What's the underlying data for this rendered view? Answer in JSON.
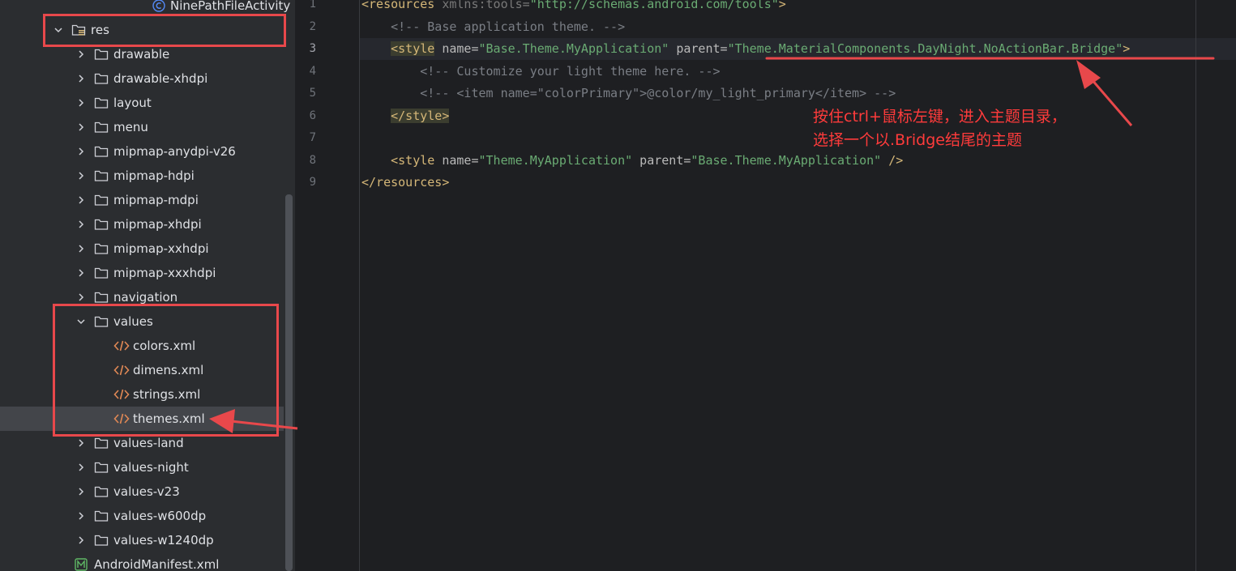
{
  "sidebar": {
    "items": [
      {
        "label": "NinePathFileActivity",
        "icon": "class-icon",
        "expanded": null
      },
      {
        "label": "res",
        "icon": "resource-folder-icon",
        "expanded": true
      },
      {
        "label": "drawable",
        "icon": "folder-icon",
        "expanded": false
      },
      {
        "label": "drawable-xhdpi",
        "icon": "folder-icon",
        "expanded": false
      },
      {
        "label": "layout",
        "icon": "folder-icon",
        "expanded": false
      },
      {
        "label": "menu",
        "icon": "folder-icon",
        "expanded": false
      },
      {
        "label": "mipmap-anydpi-v26",
        "icon": "folder-icon",
        "expanded": false
      },
      {
        "label": "mipmap-hdpi",
        "icon": "folder-icon",
        "expanded": false
      },
      {
        "label": "mipmap-mdpi",
        "icon": "folder-icon",
        "expanded": false
      },
      {
        "label": "mipmap-xhdpi",
        "icon": "folder-icon",
        "expanded": false
      },
      {
        "label": "mipmap-xxhdpi",
        "icon": "folder-icon",
        "expanded": false
      },
      {
        "label": "mipmap-xxxhdpi",
        "icon": "folder-icon",
        "expanded": false
      },
      {
        "label": "navigation",
        "icon": "folder-icon",
        "expanded": false
      },
      {
        "label": "values",
        "icon": "folder-icon",
        "expanded": true
      },
      {
        "label": "colors.xml",
        "icon": "xml-file-icon",
        "expanded": null
      },
      {
        "label": "dimens.xml",
        "icon": "xml-file-icon",
        "expanded": null
      },
      {
        "label": "strings.xml",
        "icon": "xml-file-icon",
        "expanded": null
      },
      {
        "label": "themes.xml",
        "icon": "xml-file-icon",
        "expanded": null,
        "selected": true
      },
      {
        "label": "values-land",
        "icon": "folder-icon",
        "expanded": false
      },
      {
        "label": "values-night",
        "icon": "folder-icon",
        "expanded": false
      },
      {
        "label": "values-v23",
        "icon": "folder-icon",
        "expanded": false
      },
      {
        "label": "values-w600dp",
        "icon": "folder-icon",
        "expanded": false
      },
      {
        "label": "values-w1240dp",
        "icon": "folder-icon",
        "expanded": false
      },
      {
        "label": "AndroidManifest.xml",
        "icon": "manifest-icon",
        "expanded": null
      }
    ]
  },
  "editor": {
    "current_line": 3,
    "line_numbers": [
      "1",
      "2",
      "3",
      "4",
      "5",
      "6",
      "7",
      "8",
      "9"
    ],
    "lines": [
      [
        {
          "t": "<resources",
          "c": "tag"
        },
        {
          "t": " xmlns:tools=",
          "c": "ns"
        },
        {
          "t": "\"http://schemas.android.com/tools\"",
          "c": "str"
        },
        {
          "t": ">",
          "c": "tag"
        }
      ],
      [
        {
          "t": "    <!-- Base application theme. -->",
          "c": "cmt"
        }
      ],
      [
        {
          "t": "    "
        },
        {
          "t": "<style",
          "c": "tag",
          "hl": true
        },
        {
          "t": " name=",
          "c": "attr"
        },
        {
          "t": "\"Base.Theme.MyApplication\"",
          "c": "str"
        },
        {
          "t": " parent=",
          "c": "attr"
        },
        {
          "t": "\"Theme.MaterialComponents.DayNight.NoActionBar.Bridge\"",
          "c": "str",
          "ul": true
        },
        {
          "t": ">",
          "c": "tag"
        }
      ],
      [
        {
          "t": "        <!-- Customize your light theme here. -->",
          "c": "cmt"
        }
      ],
      [
        {
          "t": "        <!-- <item name=\"colorPrimary\">@color/my_light_primary</item> -->",
          "c": "cmt"
        }
      ],
      [
        {
          "t": "    "
        },
        {
          "t": "</style>",
          "c": "tag",
          "hl": true
        }
      ],
      [],
      [
        {
          "t": "    <style",
          "c": "tag"
        },
        {
          "t": " name=",
          "c": "attr"
        },
        {
          "t": "\"Theme.MyApplication\"",
          "c": "str"
        },
        {
          "t": " parent=",
          "c": "attr"
        },
        {
          "t": "\"Base.Theme.MyApplication\"",
          "c": "str"
        },
        {
          "t": " />",
          "c": "tag"
        }
      ],
      [
        {
          "t": "</resources>",
          "c": "tag"
        }
      ]
    ]
  },
  "annotation": {
    "line1": "按住ctrl+鼠标左键，进入主题目录，",
    "line2": "选择一个以.Bridge结尾的主题"
  },
  "colors": {
    "highlight": "#e8484b",
    "annotation_text": "#ff3b3b"
  }
}
